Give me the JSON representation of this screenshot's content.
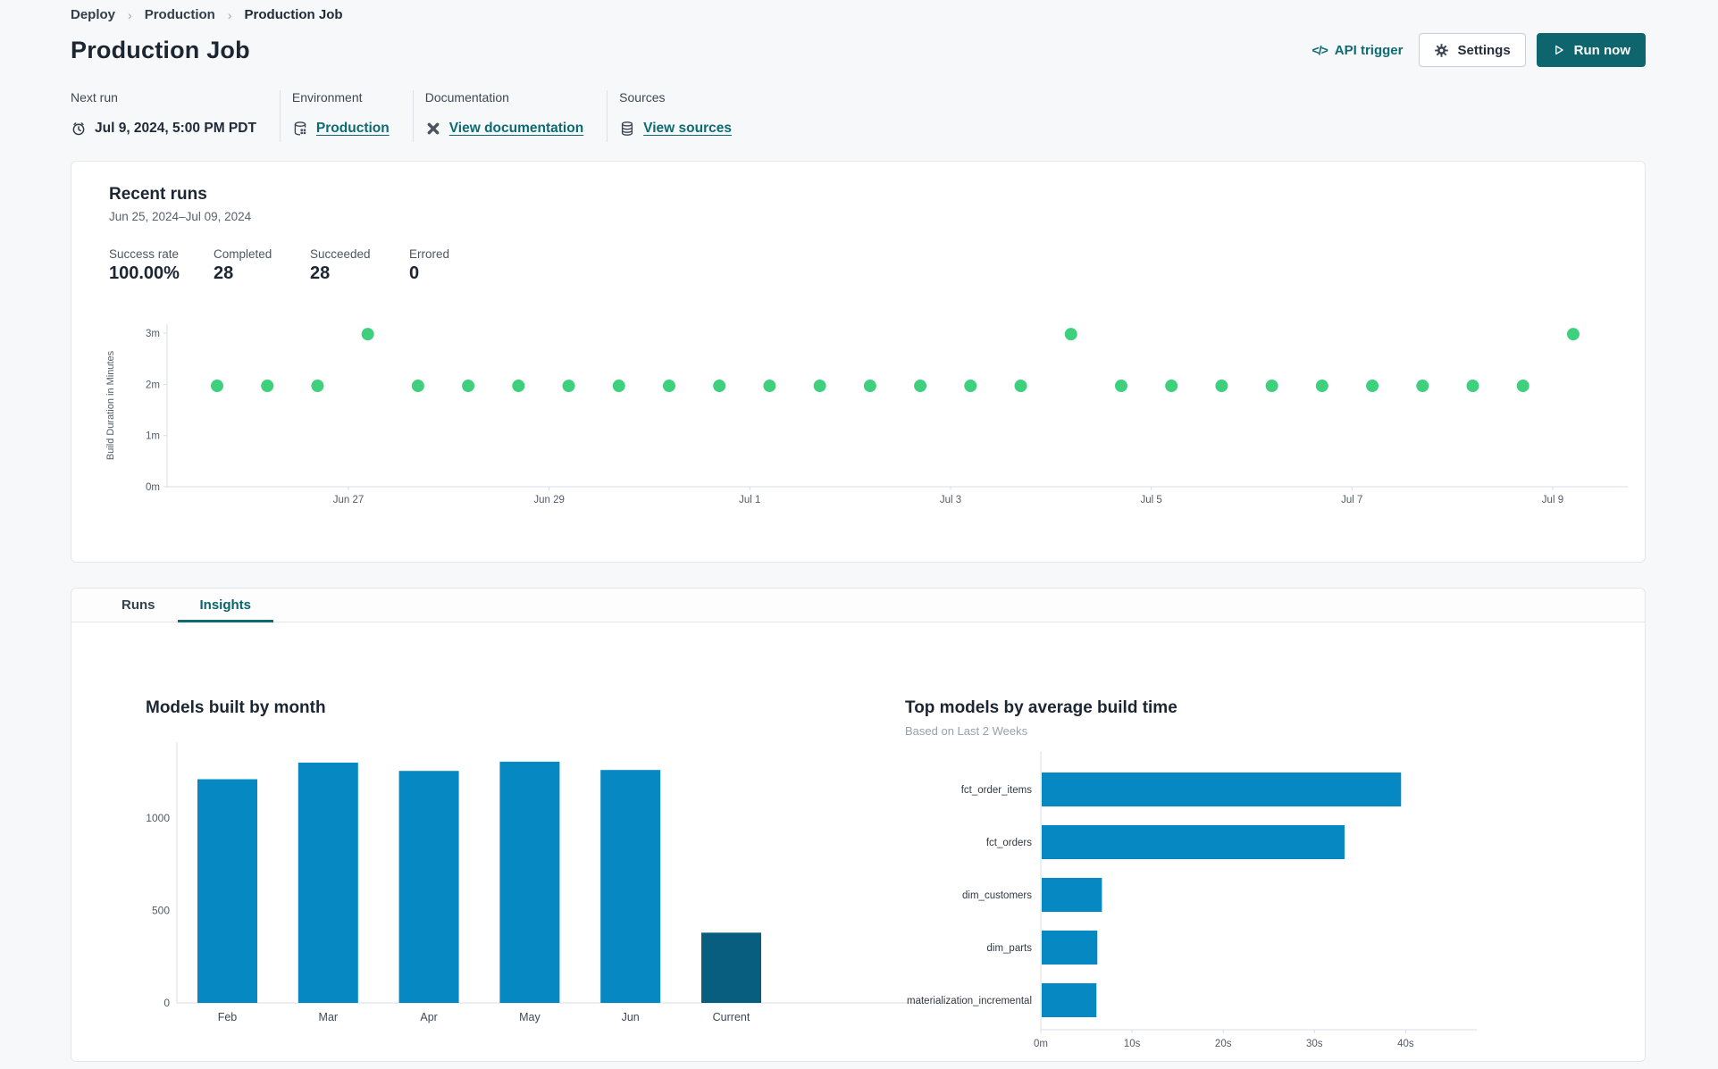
{
  "breadcrumb": {
    "items": [
      "Deploy",
      "Production",
      "Production Job"
    ],
    "separator_glyph": "›"
  },
  "header": {
    "title": "Production Job",
    "api_trigger_glyph": "</>",
    "api_trigger_label": "API trigger",
    "settings_label": "Settings",
    "run_now_label": "Run now"
  },
  "meta": {
    "next_run": {
      "label": "Next run",
      "value": "Jul 9, 2024, 5:00 PM PDT",
      "icon": "alarm-clock-icon"
    },
    "environment": {
      "label": "Environment",
      "value": "Production",
      "icon": "environment-database-icon"
    },
    "documentation": {
      "label": "Documentation",
      "value": "View documentation",
      "icon": "dbt-docs-icon"
    },
    "sources": {
      "label": "Sources",
      "value": "View sources",
      "icon": "database-icon"
    }
  },
  "recent_runs": {
    "title": "Recent runs",
    "date_range": "Jun 25, 2024–Jul 09, 2024",
    "stats": [
      {
        "label": "Success rate",
        "value": "100.00%"
      },
      {
        "label": "Completed",
        "value": "28"
      },
      {
        "label": "Succeeded",
        "value": "28"
      },
      {
        "label": "Errored",
        "value": "0"
      }
    ]
  },
  "tabs": [
    {
      "label": "Runs",
      "active": false
    },
    {
      "label": "Insights",
      "active": true
    }
  ],
  "colors": {
    "accent_teal": "#0e656d",
    "link_teal": "#0c6b73",
    "bar_blue": "#0688c3",
    "bar_dark_teal": "#085e7e",
    "dot_green": "#3ed07d"
  },
  "chart_data": [
    {
      "type": "scatter",
      "context": "Recent runs build duration over last 2 weeks",
      "ylabel": "Build Duration in Minutes",
      "y_tick_labels": [
        "0m",
        "1m",
        "2m",
        "3m"
      ],
      "x_tick_labels": [
        "Jun 27",
        "Jun 29",
        "Jul 1",
        "Jul 3",
        "Jul 5",
        "Jul 7",
        "Jul 9"
      ],
      "ylim_minutes": [
        0,
        3
      ],
      "grid": false,
      "point_color": "#3ed07d",
      "durations_minutes": [
        1.97,
        1.97,
        1.97,
        2.98,
        1.97,
        1.97,
        1.97,
        1.97,
        1.97,
        1.97,
        1.97,
        1.97,
        1.97,
        1.97,
        1.97,
        1.97,
        1.97,
        2.98,
        1.97,
        1.97,
        1.97,
        1.97,
        1.97,
        1.97,
        1.97,
        1.97,
        1.97,
        2.98
      ]
    },
    {
      "type": "bar",
      "title": "Models built by month",
      "categories": [
        "Feb",
        "Mar",
        "Apr",
        "May",
        "Jun",
        "Current"
      ],
      "values": [
        1210,
        1300,
        1255,
        1305,
        1260,
        380
      ],
      "bar_colors": [
        "#0688c3",
        "#0688c3",
        "#0688c3",
        "#0688c3",
        "#0688c3",
        "#085e7e"
      ],
      "y_ticks": [
        0,
        500,
        1000
      ],
      "ylim": [
        0,
        1425
      ],
      "grid": false
    },
    {
      "type": "bar-horizontal",
      "title": "Top models by average build time",
      "subtitle": "Based on Last 2 Weeks",
      "categories": [
        "fct_order_items",
        "fct_orders",
        "dim_customers",
        "dim_parts",
        "materialization_incremental"
      ],
      "values_seconds": [
        39.4,
        33.2,
        6.6,
        6.1,
        6.0
      ],
      "x_tick_labels": [
        "0m",
        "10s",
        "20s",
        "30s",
        "40s"
      ],
      "xlim_seconds": [
        0,
        48
      ],
      "bar_color": "#0688c3",
      "grid": false
    }
  ]
}
